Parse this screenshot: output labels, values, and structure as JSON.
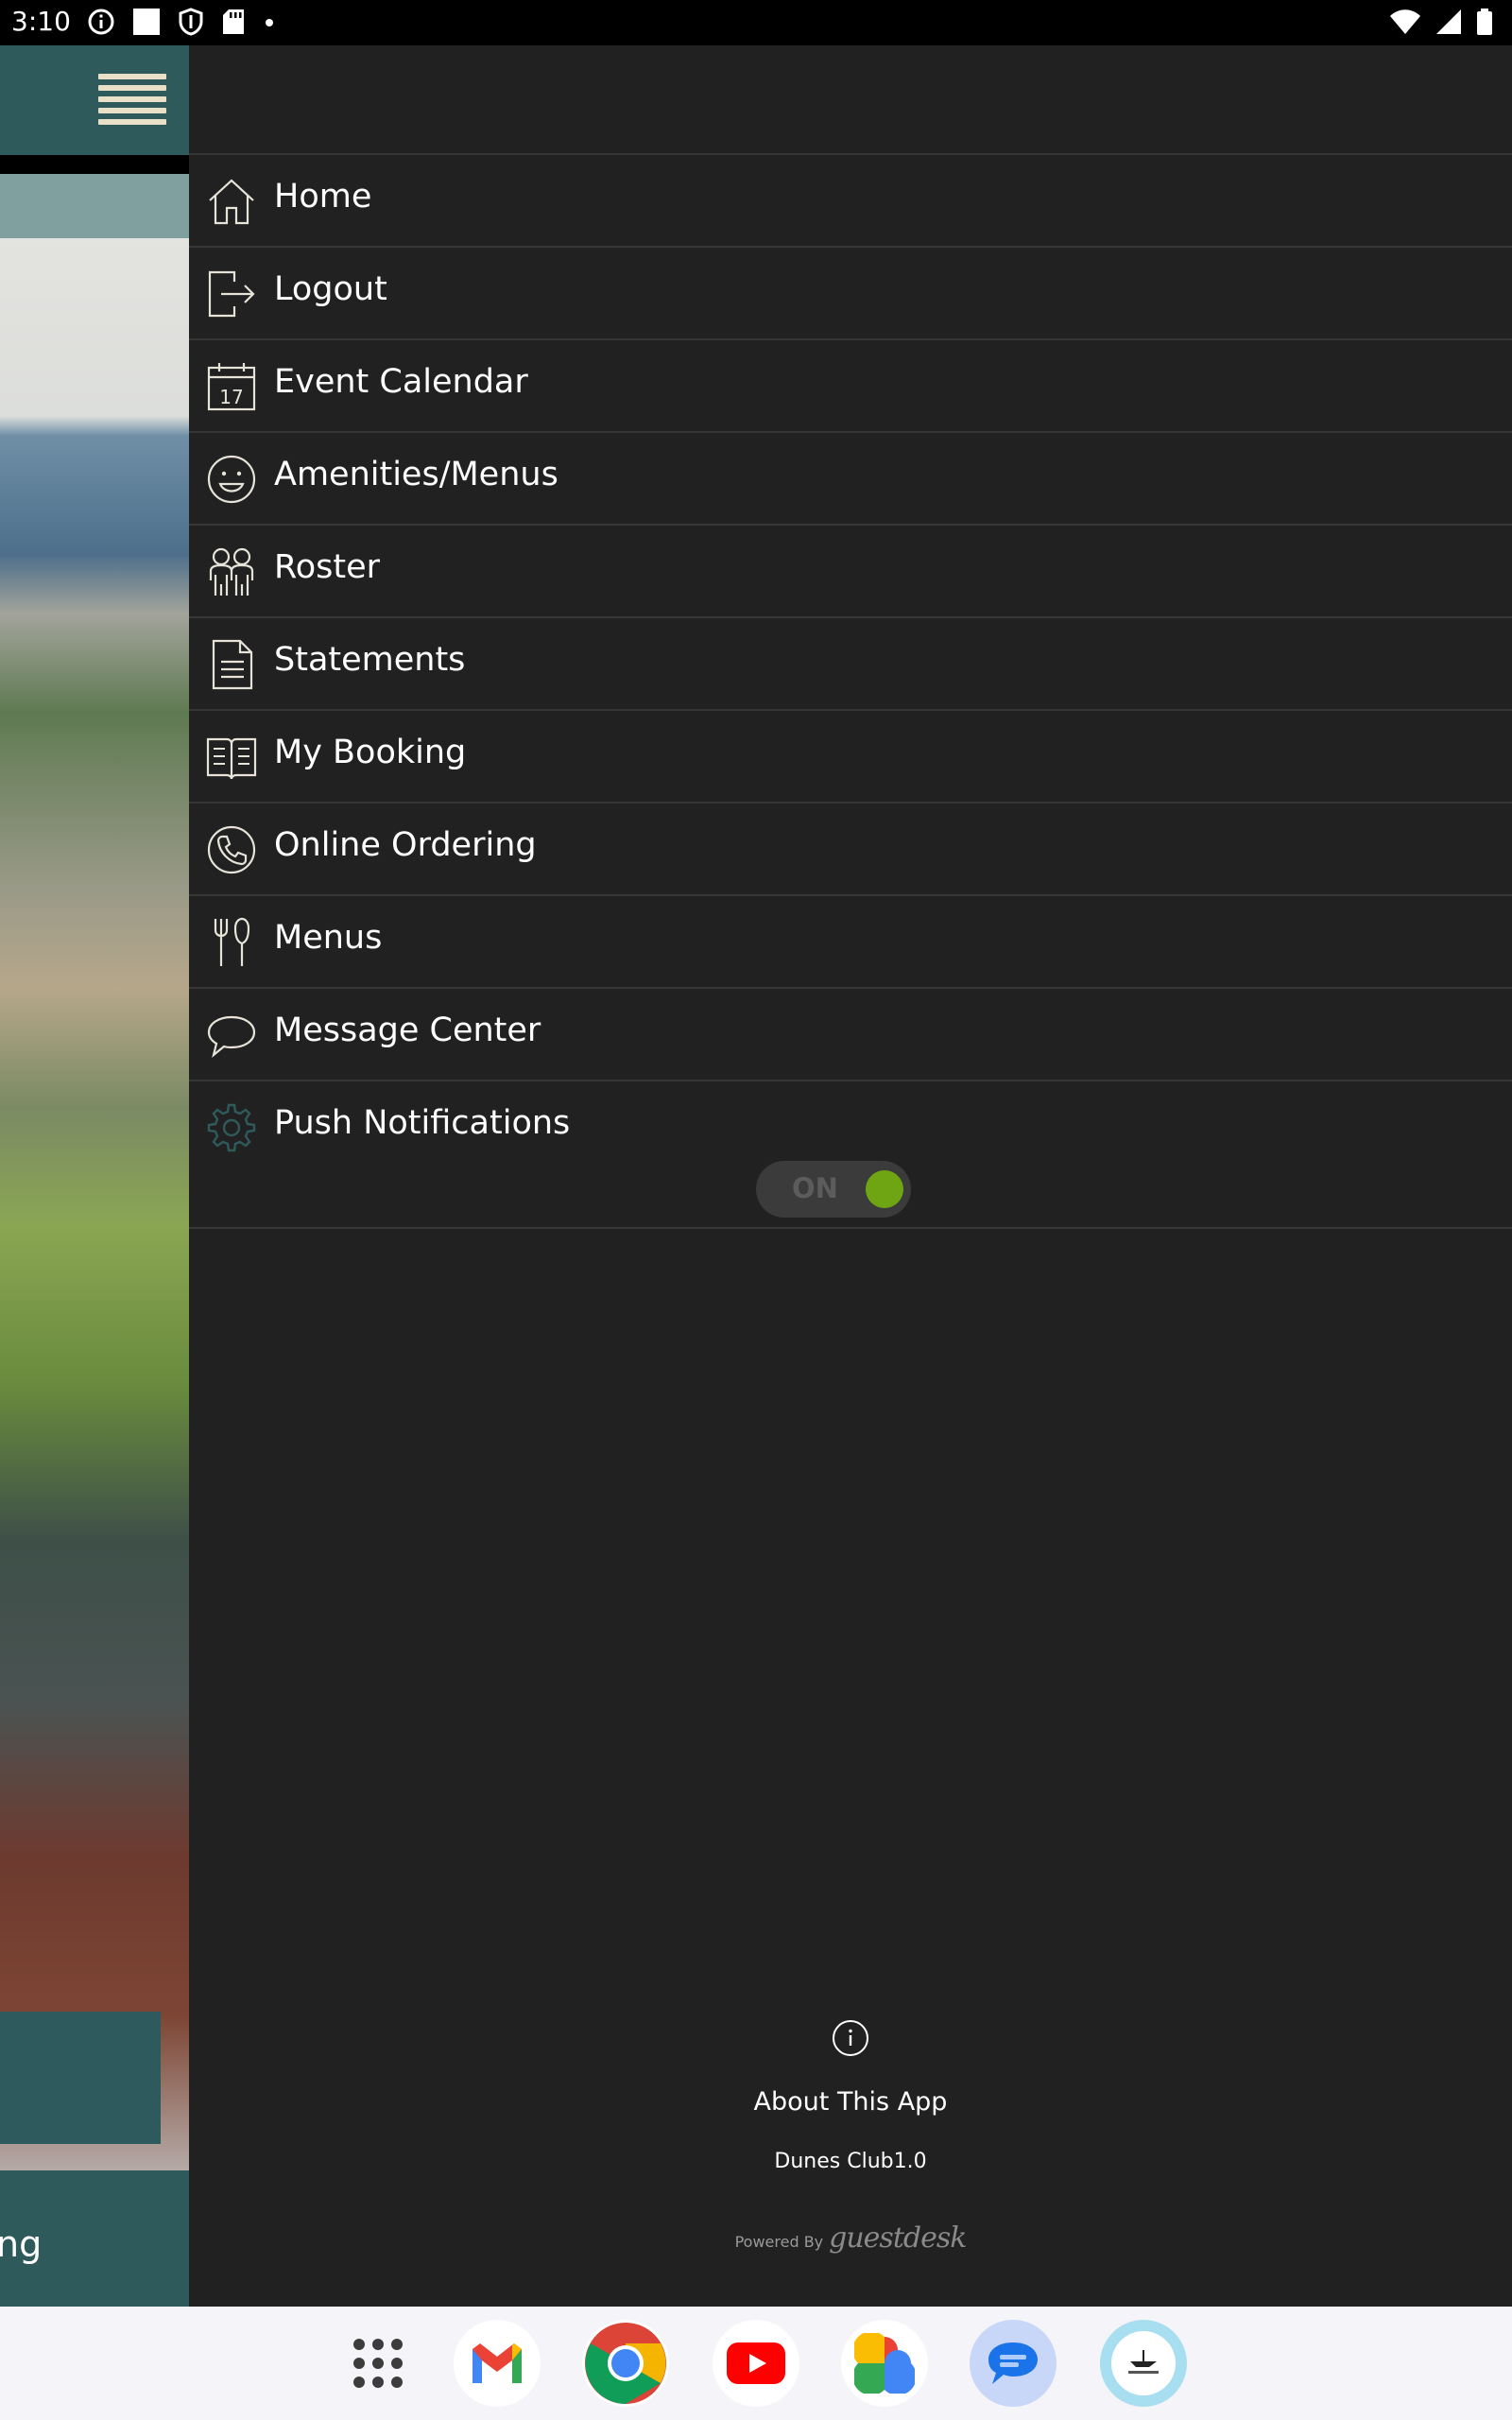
{
  "status_bar": {
    "time": "3:10",
    "left_icons": [
      "info-icon",
      "square-icon",
      "shield-icon",
      "sd-card-icon",
      "dot-icon"
    ],
    "right_icons": [
      "wifi-icon",
      "signal-icon",
      "battery-icon"
    ]
  },
  "background_app": {
    "bottom_text": "ng",
    "colors": {
      "header": "#2e5a5c",
      "hamburger": "#e8e0c8"
    }
  },
  "drawer": {
    "items": [
      {
        "label": "Home",
        "icon": "home-icon"
      },
      {
        "label": "Logout",
        "icon": "logout-icon"
      },
      {
        "label": "Event Calendar",
        "icon": "calendar-icon",
        "icon_text": "17"
      },
      {
        "label": "Amenities/Menus",
        "icon": "smiley-icon"
      },
      {
        "label": "Roster",
        "icon": "people-icon"
      },
      {
        "label": "Statements",
        "icon": "document-icon"
      },
      {
        "label": "My Booking",
        "icon": "book-icon"
      },
      {
        "label": "Online Ordering",
        "icon": "phone-icon"
      },
      {
        "label": "Menus",
        "icon": "fork-knife-icon"
      },
      {
        "label": "Message Center",
        "icon": "chat-bubble-icon"
      }
    ],
    "push": {
      "label": "Push Notifications",
      "icon": "gear-icon",
      "toggle_label": "ON",
      "toggle_on": true,
      "toggle_color": "#6fa512"
    },
    "about": {
      "icon": "info-icon",
      "title": "About This App",
      "version": "Dunes Club1.0",
      "powered_by": "Powered By",
      "brand": "guestdesk"
    }
  },
  "dock": {
    "apps": [
      "app-drawer-icon",
      "gmail-icon",
      "chrome-icon",
      "youtube-icon",
      "photos-icon",
      "messages-icon",
      "dunes-club-icon"
    ]
  }
}
